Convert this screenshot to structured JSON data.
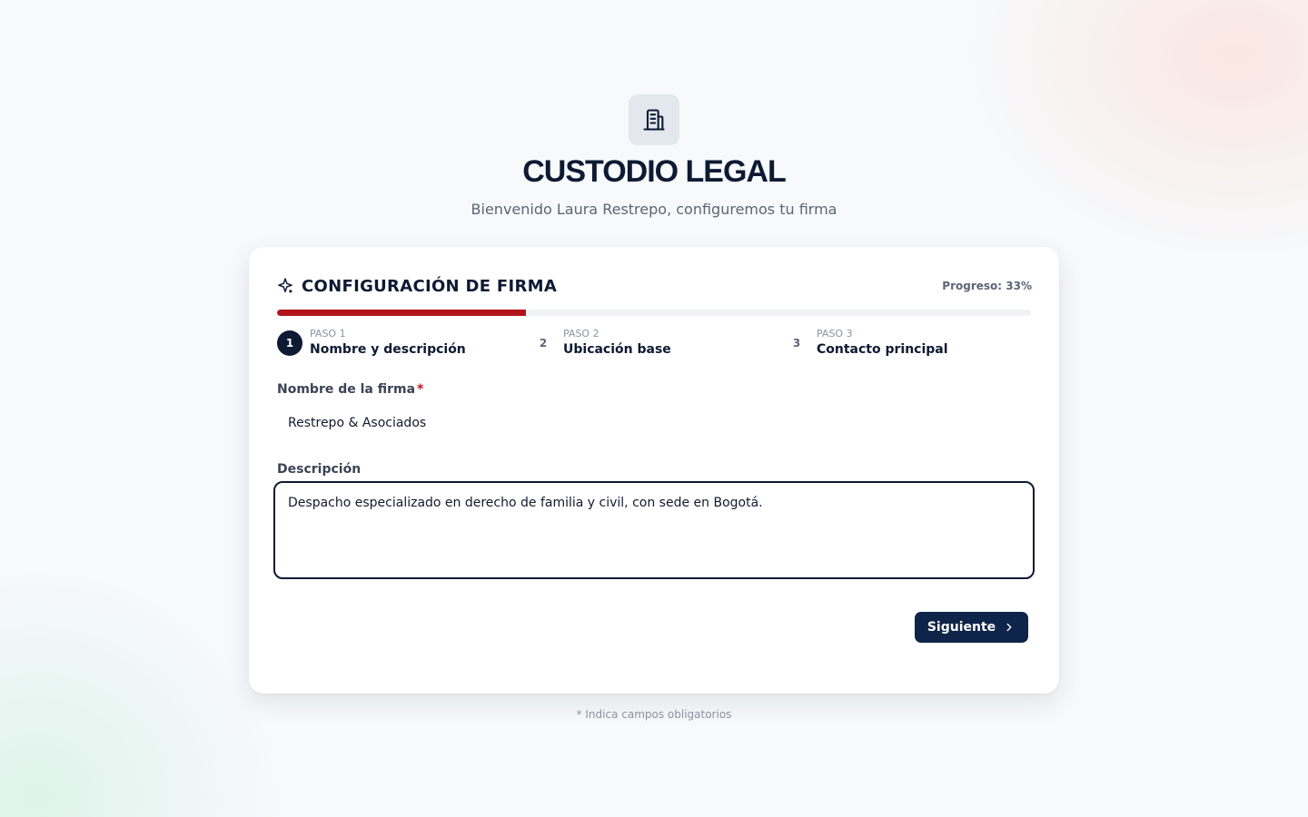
{
  "brand": {
    "title": "CUSTODIO LEGAL",
    "welcome": "Bienvenido Laura Restrepo, configuremos tu firma",
    "logo_icon": "building-icon"
  },
  "card": {
    "title": "CONFIGURACIÓN DE FIRMA",
    "title_icon": "sparkle-icon",
    "progress_text": "Progreso: 33%",
    "progress_fraction": 0.33,
    "accent_color": "#b3141c",
    "primary_color": "#0e1a33"
  },
  "steps": [
    {
      "kicker": "PASO 1",
      "number": "1",
      "label": "Nombre y descripción",
      "active": true
    },
    {
      "kicker": "PASO 2",
      "number": "2",
      "label": "Ubicación base",
      "active": false
    },
    {
      "kicker": "PASO 3",
      "number": "3",
      "label": "Contacto principal",
      "active": false
    }
  ],
  "form": {
    "name_label": "Nombre de la firma",
    "required_mark": "*",
    "name_value": "Restrepo & Asociados",
    "description_label": "Descripción",
    "description_value": "Despacho especializado en derecho de familia y civil, con sede en Bogotá."
  },
  "actions": {
    "next_label": "Siguiente",
    "next_icon": "chevron-right-icon"
  },
  "footnote": "* Indica campos obligatorios"
}
